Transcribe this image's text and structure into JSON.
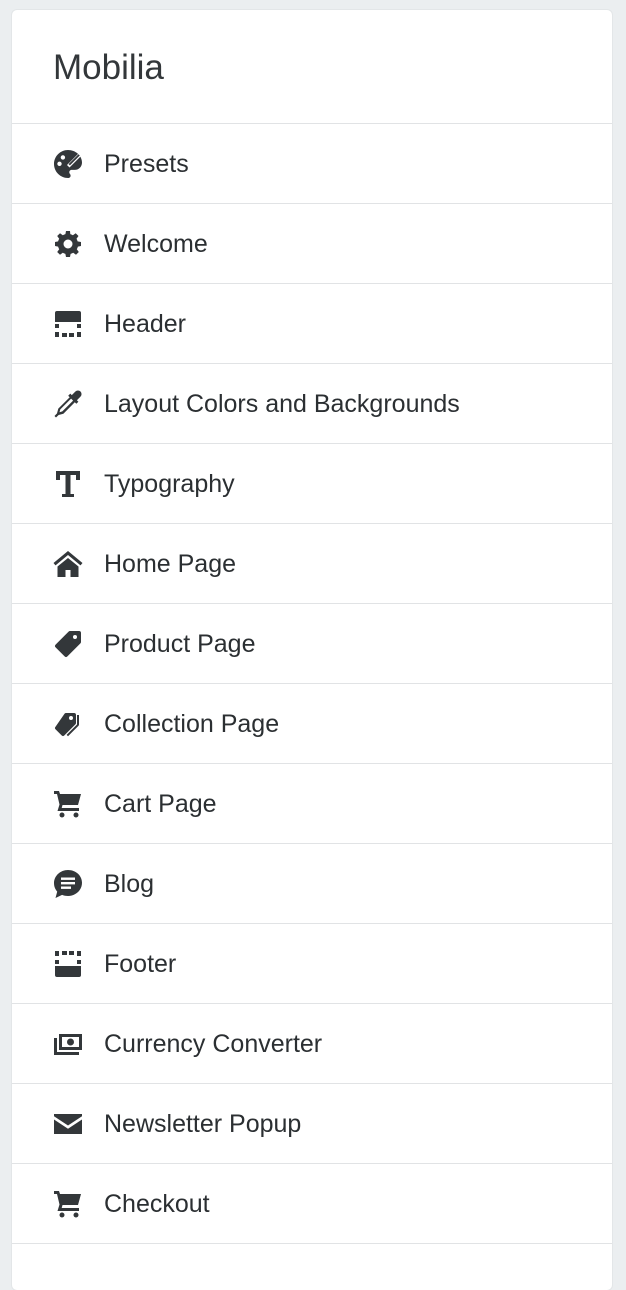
{
  "panel": {
    "title": "Mobilia"
  },
  "menu": {
    "items": [
      {
        "label": "Presets",
        "icon": "palette-icon"
      },
      {
        "label": "Welcome",
        "icon": "gear-icon"
      },
      {
        "label": "Header",
        "icon": "header-layout-icon"
      },
      {
        "label": "Layout Colors and Backgrounds",
        "icon": "eyedropper-icon"
      },
      {
        "label": "Typography",
        "icon": "text-t-icon"
      },
      {
        "label": "Home Page",
        "icon": "home-icon"
      },
      {
        "label": "Product Page",
        "icon": "tag-icon"
      },
      {
        "label": "Collection Page",
        "icon": "tags-icon"
      },
      {
        "label": "Cart Page",
        "icon": "cart-icon"
      },
      {
        "label": "Blog",
        "icon": "chat-bubble-icon"
      },
      {
        "label": "Footer",
        "icon": "footer-layout-icon"
      },
      {
        "label": "Currency Converter",
        "icon": "money-icon"
      },
      {
        "label": "Newsletter Popup",
        "icon": "envelope-icon"
      },
      {
        "label": "Checkout",
        "icon": "cart-icon"
      }
    ]
  },
  "colors": {
    "background": "#ebeef0",
    "panel": "#ffffff",
    "text": "#2b2f32",
    "divider": "#e1e3e5"
  }
}
